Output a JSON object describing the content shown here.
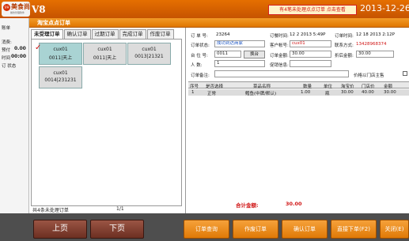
{
  "header": {
    "logo_badge": "宝客",
    "logo_name": "美食尚",
    "logo_sub": "餐饮管理软件",
    "app_version": "V8",
    "notice": "有4笔未处理点点订单 点击查看",
    "date": "2013-12-26"
  },
  "left_strip": {
    "station": "账单",
    "consume": "消费:",
    "prepay_label": "预付",
    "prepay_value": "0.00",
    "time_label": "时间",
    "time_value": "00:00",
    "status": "订 状态"
  },
  "panel": {
    "title": "淘宝点点订单"
  },
  "tabs": [
    {
      "label": "未受理订单",
      "active": true
    },
    {
      "label": "确认订单",
      "active": false
    },
    {
      "label": "过期订单",
      "active": false
    },
    {
      "label": "完成订单",
      "active": false
    },
    {
      "label": "作废订单",
      "active": false
    }
  ],
  "orders": [
    {
      "name": "cux01",
      "table": "0011|天上",
      "selected": true
    },
    {
      "name": "cux01",
      "table": "0011|天上",
      "selected": false
    },
    {
      "name": "cux01",
      "table": "0013|21321",
      "selected": false
    },
    {
      "name": "cux01",
      "table": "0014|231231",
      "selected": false
    }
  ],
  "pager": {
    "summary": "共4条未处理订单",
    "page": "1/1"
  },
  "detail": {
    "order_no_label": "订 单 号:",
    "order_no": "23264",
    "order_time_label": "订餐时间:",
    "order_time": "12 2 2013 5:49P",
    "deliver_time_label": "订单时间:",
    "deliver_time": "12 18 2013 2:12P",
    "status_label": "订单状态:",
    "status_value": "成功到达商家",
    "customer_label": "客户帐号:",
    "customer": "cux01",
    "phone_label": "联系方式:",
    "phone": "13428968374",
    "table_label": "台 位 号:",
    "table_value": "0011",
    "pick_button": "换台",
    "amount_label": "订单金额:",
    "amount": "30.00",
    "discount_label": "折后金额:",
    "discount": "30.00",
    "people_label": "人    数:",
    "people": "1",
    "promo_label": "促销信息:",
    "promo": "",
    "remark_label": "订单备注:",
    "remark": "",
    "print_label": "价格以门店主售"
  },
  "items_table": {
    "columns": [
      "序号",
      "是否选择",
      "菜品名称",
      "数量",
      "单位",
      "淘宝价",
      "门店价",
      "金额"
    ],
    "rows": [
      [
        "1",
        "正常",
        "鳕鱼(中牌/默认)",
        "1.00",
        "瓶",
        "30.00",
        "40.00",
        "30.00"
      ]
    ]
  },
  "total": {
    "label": "合计金额:",
    "value": "30.00"
  },
  "buttons": {
    "prev": "上页",
    "next": "下页",
    "query": "订单查询",
    "void": "作废订单",
    "confirm": "确认订单",
    "direct": "直接下单(F2)",
    "close": "关闭(E)"
  },
  "colors": {
    "accent": "#e07700",
    "danger": "#d01515",
    "nav": "#6d2f22"
  }
}
